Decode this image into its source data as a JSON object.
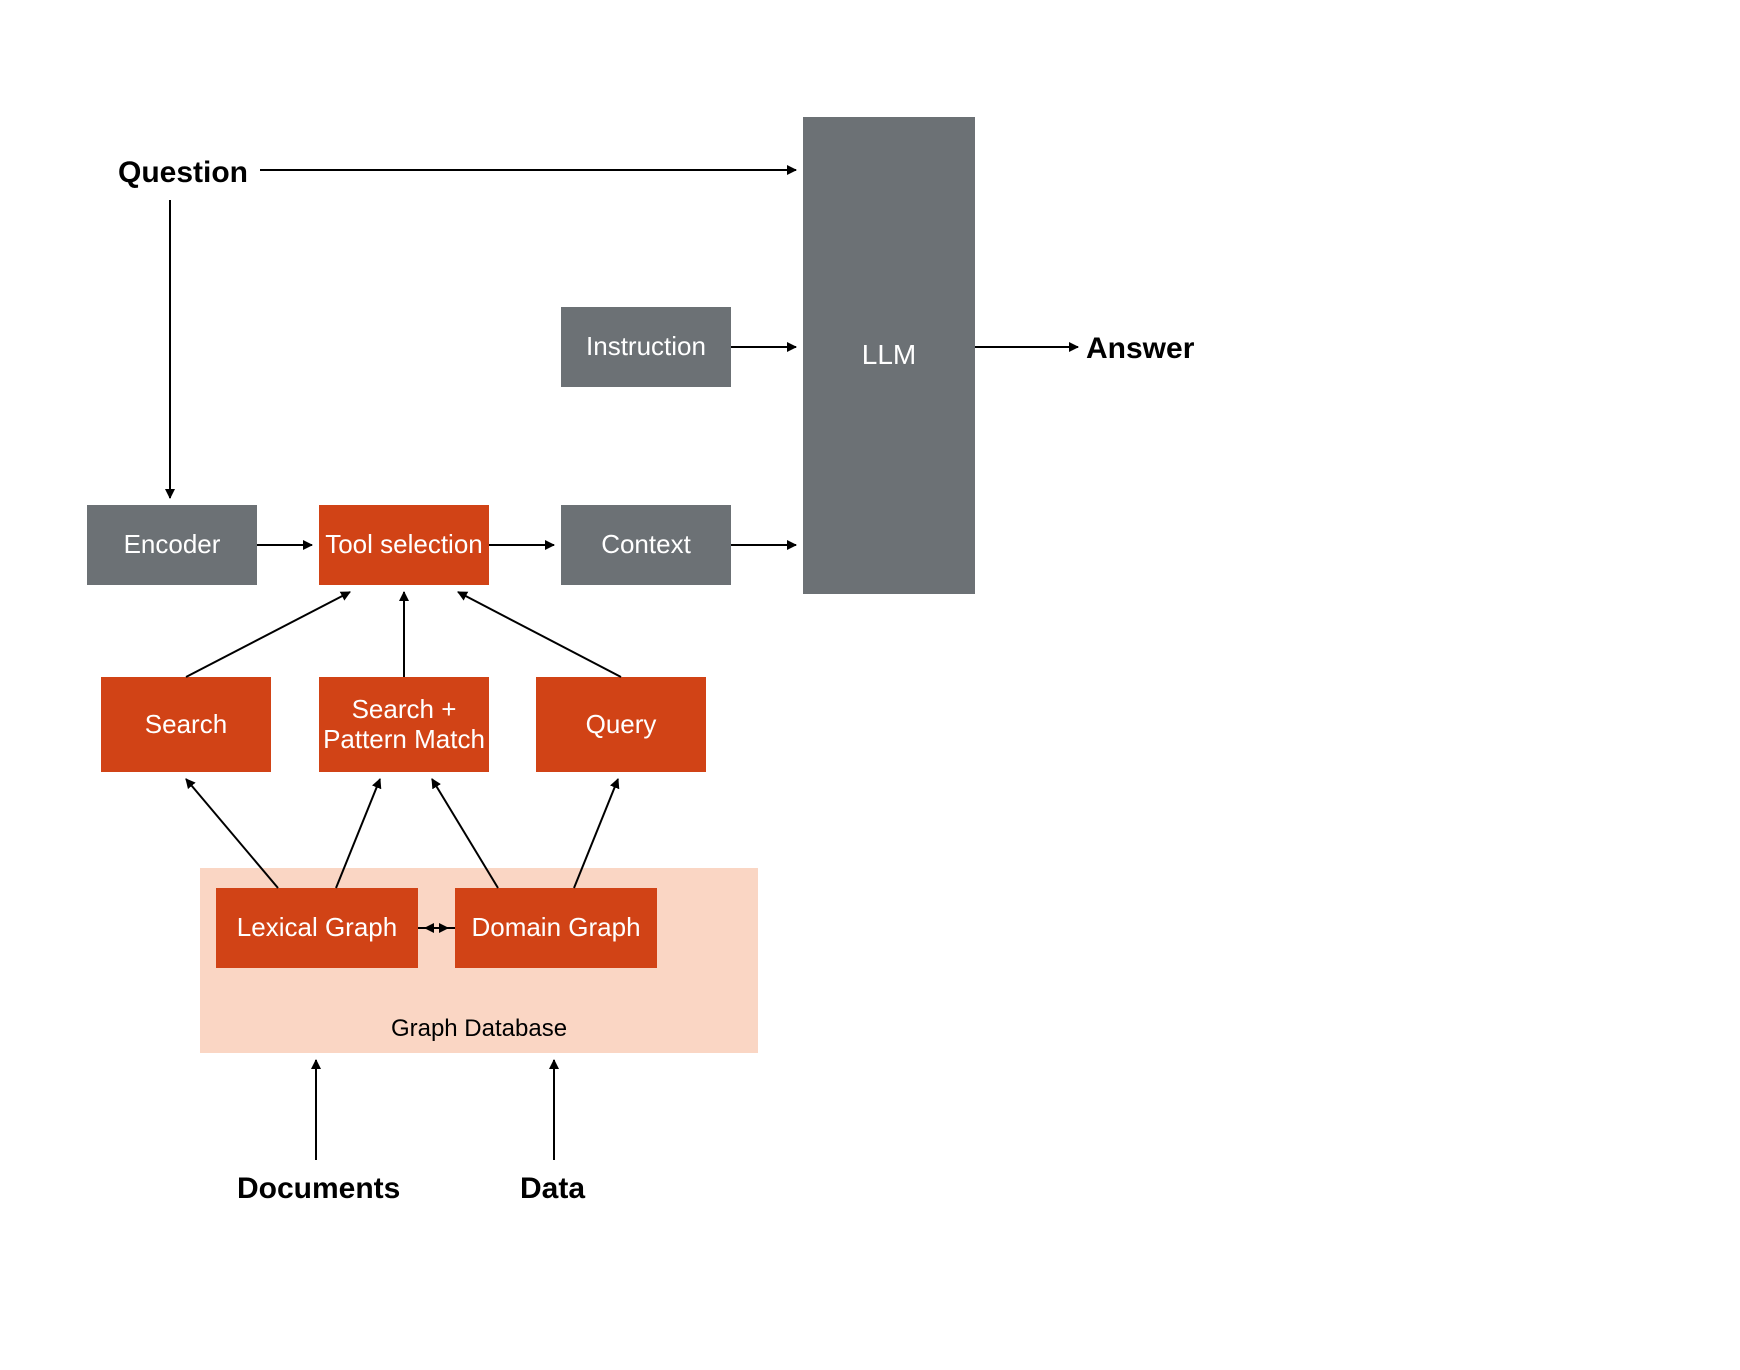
{
  "labels": {
    "question": "Question",
    "answer": "Answer",
    "documents": "Documents",
    "data": "Data"
  },
  "boxes": {
    "encoder": "Encoder",
    "tool_selection": "Tool selection",
    "context": "Context",
    "instruction": "Instruction",
    "llm": "LLM",
    "search": "Search",
    "search_pattern": "Search +\nPattern Match",
    "query": "Query",
    "lexical_graph": "Lexical Graph",
    "domain_graph": "Domain Graph",
    "graph_database": "Graph Database"
  },
  "colors": {
    "gray": "#6c7175",
    "orange": "#d14316",
    "light_orange": "#fad6c4"
  }
}
